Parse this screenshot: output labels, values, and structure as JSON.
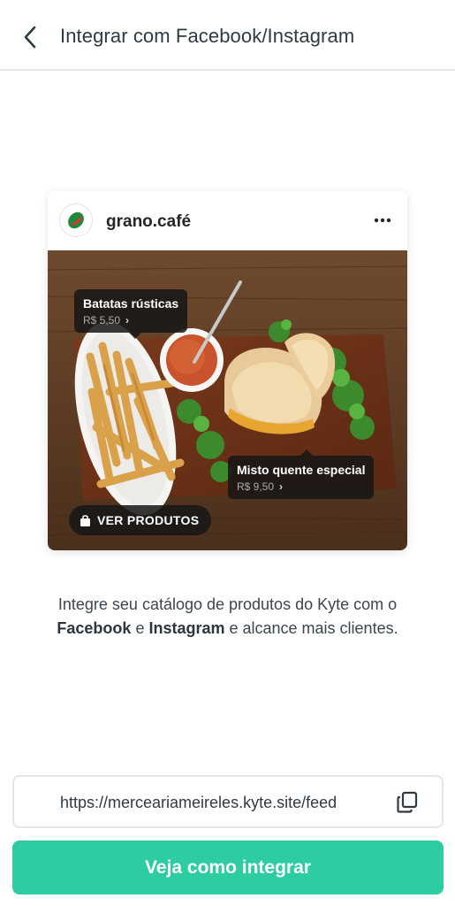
{
  "header": {
    "title": "Integrar com Facebook/Instagram",
    "back_icon": "chevron-left-icon"
  },
  "post_preview": {
    "account_name": "grano.café",
    "more_icon": "more-horizontal-icon",
    "tags": [
      {
        "name": "Batatas rústicas",
        "price": "R$ 5,50"
      },
      {
        "name": "Misto quente especial",
        "price": "R$ 9,50"
      }
    ],
    "shop_button_label": "VER PRODUTOS",
    "shop_icon": "shopping-bag-icon"
  },
  "description": {
    "part1": "Integre seu catálogo de produtos do Kyte com o ",
    "facebook": "Facebook",
    "conj": " e ",
    "instagram": "Instagram",
    "part2": " e alcance mais clientes."
  },
  "feed_url": {
    "value": "https://merceariameireles.kyte.site/feed",
    "copy_icon": "copy-icon"
  },
  "cta": {
    "label": "Veja como integrar"
  },
  "colors": {
    "accent": "#2dcca3",
    "text": "#2e3a44"
  }
}
